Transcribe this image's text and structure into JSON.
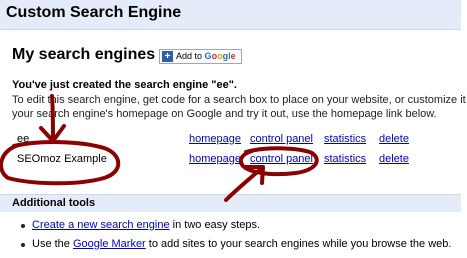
{
  "header": {
    "title": "Custom Search Engine"
  },
  "section": {
    "title": "My search engines",
    "add_button": {
      "prefix": "Add to",
      "brand": [
        "G",
        "o",
        "o",
        "g",
        "l",
        "e"
      ]
    }
  },
  "message": {
    "created": "You've just created the search engine \"ee\".",
    "instructions": [
      "To edit this search engine, get code for a search box to place on your website, or customize it f",
      "your search engine's homepage on Google and try it out, use the homepage link below."
    ]
  },
  "engines": [
    {
      "name": "ee",
      "links": [
        "homepage",
        "control panel",
        "statistics",
        "delete"
      ]
    },
    {
      "name": "SEOmoz Example",
      "links": [
        "homepage",
        "control panel",
        "statistics",
        "delete"
      ]
    }
  ],
  "tools": {
    "title": "Additional tools",
    "items": [
      {
        "link": "Create a new search engine",
        "rest": " in two easy steps."
      },
      {
        "before": "Use the ",
        "link": "Google Marker",
        "rest": " to add sites to your search engines while you browse the web."
      }
    ]
  },
  "annotation_color": "#8b0000"
}
